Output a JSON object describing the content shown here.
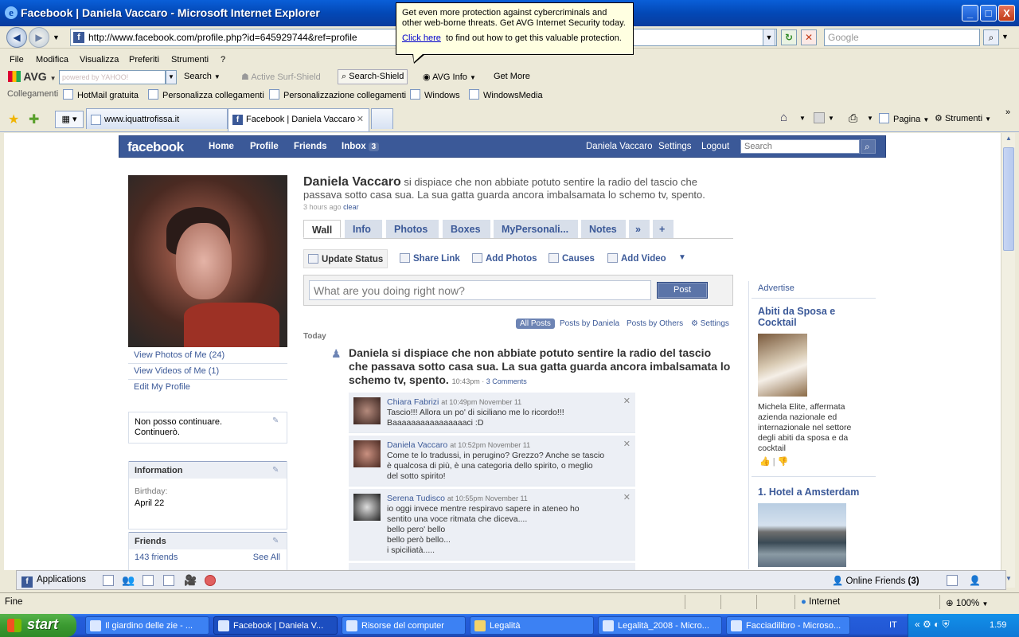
{
  "window": {
    "title": "Facebook | Daniela Vaccaro - Microsoft Internet Explorer",
    "min": "_",
    "max": "□",
    "close": "X"
  },
  "browser": {
    "address": "http://www.facebook.com/profile.php?id=645929744&ref=profile",
    "search_placeholder": "Google",
    "menu": [
      "File",
      "Modifica",
      "Visualizza",
      "Preferiti",
      "Strumenti",
      "?"
    ],
    "avg_toolbar": {
      "avg": "AVG",
      "yahoo_placeholder": "powered by YAHOO!",
      "search": "Search",
      "active_surf": "Active Surf-Shield",
      "search_shield": "Search-Shield",
      "avg_info": "AVG Info",
      "get_more": "Get More"
    },
    "links": {
      "label": "Collegamenti",
      "items": [
        "HotMail gratuita",
        "Personalizza collegamenti",
        "Personalizzazione collegamenti",
        "Windows",
        "WindowsMedia"
      ]
    },
    "tabs": [
      "www.iquattrofissa.it",
      "Facebook | Daniela Vaccaro"
    ],
    "tools": {
      "pagina": "Pagina",
      "strumenti": "Strumenti"
    },
    "status": {
      "left": "Fine",
      "zone": "Internet",
      "zoom": "100%"
    }
  },
  "tooltip": {
    "text": "Get even more protection against cybercriminals and other web-borne threats. Get AVG Internet Security today.",
    "link": "Click here",
    "after": "to find out how to get this valuable protection."
  },
  "fb": {
    "logo": "facebook",
    "nav": [
      "Home",
      "Profile",
      "Friends",
      "Inbox"
    ],
    "inbox_count": "3",
    "user": "Daniela Vaccaro",
    "settings": "Settings",
    "logout": "Logout",
    "search_placeholder": "Search"
  },
  "profile": {
    "name": "Daniela Vaccaro",
    "status": "si dispiace che non abbiate potuto sentire la radio del tascio che passava sotto casa sua. La sua gatta guarda ancora imbalsamata lo schemo tv, spento.",
    "status_time": "3 hours ago",
    "clear": "clear",
    "left_links": [
      "View Photos of Me (24)",
      "View Videos of Me (1)",
      "Edit My Profile"
    ],
    "note": "Non posso continuare. Continuerò.",
    "info_title": "Information",
    "birthday_label": "Birthday:",
    "birthday": "April 22",
    "friends_title": "Friends",
    "friends_count": "143 friends",
    "see_all": "See All"
  },
  "profile_tabs": [
    "Wall",
    "Info",
    "Photos",
    "Boxes",
    "MyPersonali...",
    "Notes",
    "»",
    "+"
  ],
  "publisher": {
    "items": [
      "Update Status",
      "Share Link",
      "Add Photos",
      "Causes",
      "Add Video"
    ],
    "placeholder": "What are you doing right now?",
    "post": "Post"
  },
  "filters": [
    "All Posts",
    "Posts by Daniela",
    "Posts by Others",
    "Settings"
  ],
  "today": "Today",
  "story": {
    "text": "Daniela si dispiace che non abbiate potuto sentire la radio del tascio che passava sotto casa sua. La sua gatta guarda ancora imbalsamata lo schemo tv, spento.",
    "time": "10:43pm",
    "comments_link": "3 Comments"
  },
  "comments": [
    {
      "name": "Chiara Fabrizi",
      "time": "at 10:49pm November 11",
      "lines": [
        "Tascio!!! Allora un po' di siciliano me lo ricordo!!!",
        "Baaaaaaaaaaaaaaaaci :D"
      ]
    },
    {
      "name": "Daniela Vaccaro",
      "time": "at 10:52pm November 11",
      "lines": [
        "Come te lo tradussi, in perugino? Grezzo? Anche se tascio",
        "è qualcosa di più, è una categoria dello spirito, o meglio",
        "del sotto spirito!"
      ]
    },
    {
      "name": "Serena Tudisco",
      "time": "at 10:55pm November 11",
      "lines": [
        "io oggi invece mentre respiravo sapere in ateneo ho",
        "sentito una voce ritmata che diceva....",
        "bello pero' bello",
        "bello però bello...",
        "i spiciliatà....."
      ]
    }
  ],
  "ads": {
    "title": "Advertise",
    "ad1_head": "Abiti da Sposa e Cocktail",
    "ad1_body": "Michela Elite, affermata azienda nazionale ed internazionale nel settore degli abiti da sposa e da cocktail",
    "ad2_head": "1. Hotel a Amsterdam"
  },
  "fbbar": {
    "applications": "Applications",
    "online": "Online Friends",
    "online_count": "(3)"
  },
  "taskbar": {
    "start": "start",
    "tasks": [
      "Il giardino delle zie - ...",
      "Facebook | Daniela V...",
      "Risorse del computer",
      "Legalità",
      "Legalità_2008 - Micro...",
      "Facciadilibro - Microso..."
    ],
    "lang": "IT",
    "clock": "1.59"
  }
}
